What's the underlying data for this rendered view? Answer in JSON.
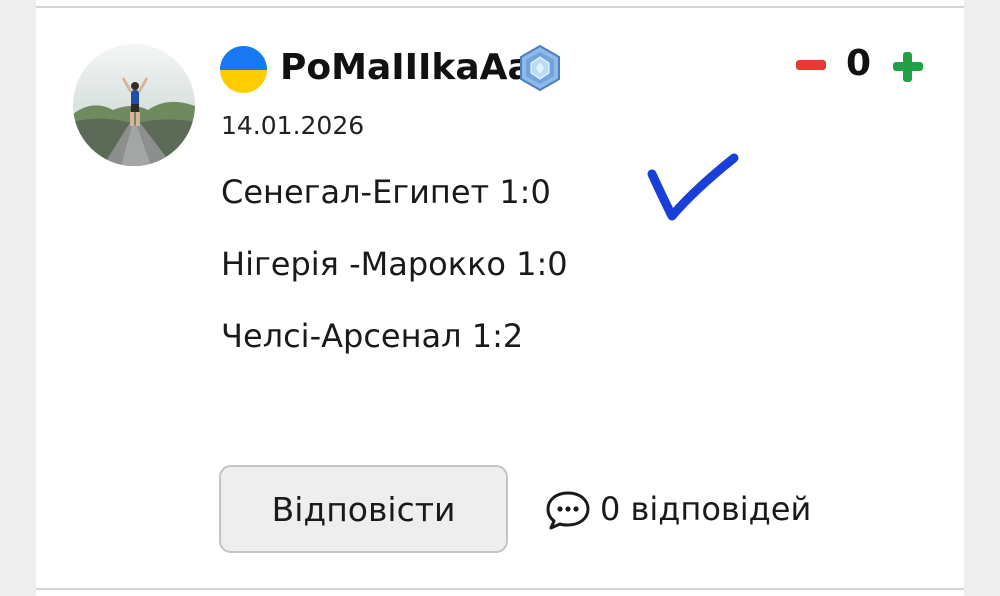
{
  "comment": {
    "username": "PoMaIIIkaAa",
    "date": "14.01.2026",
    "lines": [
      "Сенегал-Египет 1:0",
      "Нігерія -Марокко 1:0",
      "Челсі-Арсенал 1:2"
    ],
    "flag_icon": "ukraine-flag-icon",
    "badge_icon": "crystal-badge-icon",
    "check_icon": "checkmark-icon"
  },
  "vote": {
    "score": "0",
    "minus_color": "#e53935",
    "plus_color": "#22a046"
  },
  "actions": {
    "reply_label": "Відповісти",
    "replies_label": "0 відповідей",
    "replies_icon": "speech-bubble-icon"
  },
  "colors": {
    "check": "#1a3fd8",
    "flag_blue": "#1877f2",
    "flag_yellow": "#ffcc00"
  }
}
